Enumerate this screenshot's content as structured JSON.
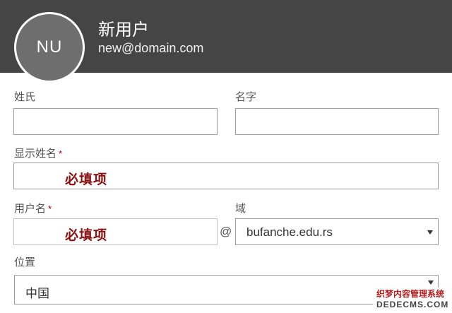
{
  "header": {
    "avatar_initials": "NU",
    "display_name": "新用户",
    "email": "new@domain.com"
  },
  "form": {
    "last_name": {
      "label": "姓氏",
      "value": ""
    },
    "first_name": {
      "label": "名字",
      "value": ""
    },
    "display_name": {
      "label": "显示姓名",
      "required_mark": "*",
      "hint": "必填项"
    },
    "username": {
      "label": "用户名",
      "required_mark": "*",
      "hint": "必填项"
    },
    "at_symbol": "@",
    "domain": {
      "label": "域",
      "selected": "bufanche.edu.rs"
    },
    "location": {
      "label": "位置",
      "selected": "中国"
    }
  },
  "watermark": {
    "line1": "织梦内容管理系统",
    "line2": "DEDECMS.COM"
  },
  "colors": {
    "header_bg": "#454545",
    "avatar_bg": "#6e6e6e",
    "required_hint": "#8b1111"
  }
}
